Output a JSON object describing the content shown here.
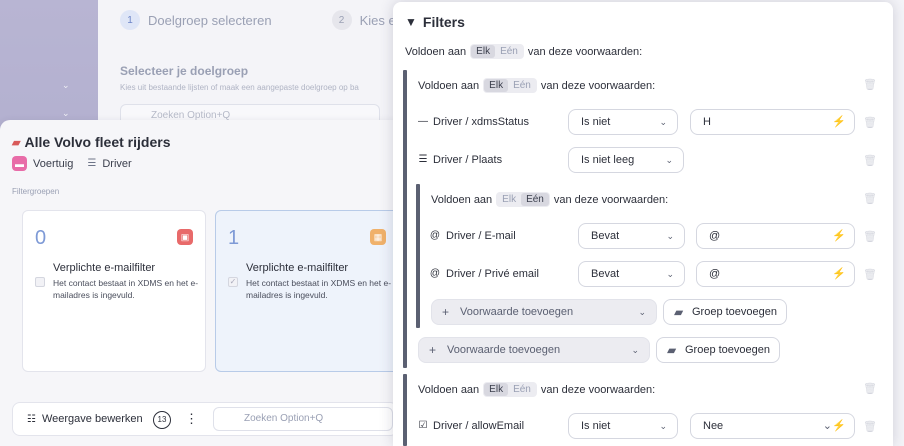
{
  "stepper": {
    "step1_num": "1",
    "step1_label": "Doelgroep selecteren",
    "step2_num": "2",
    "step2_label": "Kies ee"
  },
  "background": {
    "title": "Selecteer je doelgroep",
    "subtitle": "Kies uit bestaande lijsten of maak een aangepaste doelgroep op ba",
    "search_placeholder": "Zoeken Option+Q"
  },
  "group": {
    "title": "Alle Volvo fleet rijders",
    "tabs": [
      {
        "label": "Voertuig",
        "icon": "car-icon",
        "color": "#e86ca8"
      },
      {
        "label": "Driver",
        "icon": "database-icon",
        "color": "#6d7488"
      }
    ],
    "filtergroups_label": "Filtergroepen",
    "cards": [
      {
        "count": "0",
        "name": "Verplichte e-mailfilter",
        "description": "Het contact bestaat in XDMS en het e-mailadres is ingevuld.",
        "badge_color": "#e86a6a"
      },
      {
        "count": "1",
        "name": "Verplichte e-mailfilter",
        "description": "Het contact bestaat in XDMS en het e-mailadres is ingevuld.",
        "badge_color": "#f0b16a"
      }
    ],
    "bottom": {
      "edit_label": "Weergave bewerken",
      "count": "13",
      "search_placeholder": "Zoeken Option+Q"
    }
  },
  "filters": {
    "title": "Filters",
    "prefix": "Voldoen aan",
    "suffix": "van deze voorwaarden:",
    "opt_all": "Elk",
    "opt_any": "Eén",
    "rows": {
      "status": {
        "field": "Driver / xdmsStatus",
        "operator": "Is niet",
        "value": "H"
      },
      "plaats": {
        "field": "Driver / Plaats",
        "operator": "Is niet leeg"
      },
      "email": {
        "field": "Driver / E-mail",
        "operator": "Bevat",
        "value": "@"
      },
      "prive": {
        "field": "Driver / Privé email",
        "operator": "Bevat",
        "value": "@"
      },
      "allow": {
        "field": "Driver / allowEmail",
        "operator": "Is niet",
        "value": "Nee"
      }
    },
    "add_condition": "Voorwaarde toevoegen",
    "add_group": "Groep toevoegen"
  },
  "colors": {
    "accent": "#7e9ad6",
    "bar": "#5b6072"
  }
}
